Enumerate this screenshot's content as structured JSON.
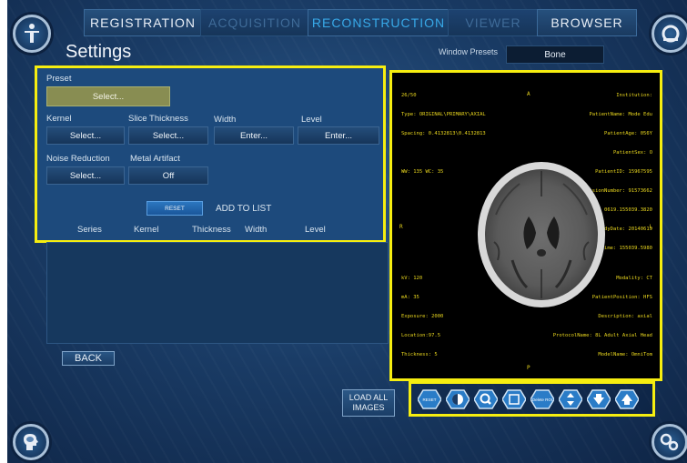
{
  "tabs": [
    {
      "label": "REGISTRATION"
    },
    {
      "label": "ACQUISITION"
    },
    {
      "label": "RECONSTRUCTION"
    },
    {
      "label": "VIEWER"
    },
    {
      "label": "BROWSER"
    }
  ],
  "page": {
    "title": "Settings"
  },
  "window_presets": {
    "label": "Window Presets",
    "value": "Bone"
  },
  "settings": {
    "preset": {
      "label": "Preset",
      "value": "Select..."
    },
    "kernel": {
      "label": "Kernel",
      "value": "Select..."
    },
    "slice_thickness": {
      "label": "Slice Thickness",
      "value": "Select..."
    },
    "width": {
      "label": "Width",
      "value": "Enter..."
    },
    "level": {
      "label": "Level",
      "value": "Enter..."
    },
    "noise_reduction": {
      "label": "Noise Reduction",
      "value": "Select..."
    },
    "metal_artifact": {
      "label": "Metal Artifact",
      "value": "Off"
    },
    "reset_label": "RESET",
    "add_label": "ADD TO LIST",
    "columns": [
      "Series",
      "Kernel",
      "Thickness",
      "Width",
      "Level"
    ]
  },
  "back_label": "BACK",
  "load_all_label": "LOAD ALL IMAGES",
  "viewer": {
    "top_left": [
      "26/50",
      "Type: ORIGINAL\\PRIMARY\\AXIAL",
      "Spacing: 0.4132813\\0.4132813",
      "",
      "WW: 135 WC: 35"
    ],
    "top_right": [
      "Institution:",
      "PatientName: Mode Edu",
      "PatientAge: 056Y",
      "PatientSex: O",
      "PatientID: 15967595",
      "AccessionNumber: 91573662",
      "StudyID: 0619.155039.3820",
      "StudyDate: 20140619",
      "StudyTime: 155039.5980"
    ],
    "bottom_left": [
      "kV: 120",
      "mA: 35",
      "Exposure: 2000",
      "Location:97.5",
      "Thickness: 5"
    ],
    "bottom_right": [
      "Modality: CT",
      "PatientPosition: HFS",
      "Description: axial",
      "ProtocolName: 8L Adult Axial Head",
      "ModelName: OmniTom"
    ],
    "orientation": {
      "top": "A",
      "bottom": "P",
      "left": "R",
      "right": "L"
    }
  },
  "toolbar": [
    {
      "icon": "reset-icon",
      "label": "RESET"
    },
    {
      "icon": "contrast-icon",
      "label": ""
    },
    {
      "icon": "zoom-icon",
      "label": ""
    },
    {
      "icon": "square-icon",
      "label": ""
    },
    {
      "icon": "delete-roi-icon",
      "label": "Delete ROI"
    },
    {
      "icon": "move-icon",
      "label": ""
    },
    {
      "icon": "arrow-down-icon",
      "label": ""
    },
    {
      "icon": "arrow-up-icon",
      "label": ""
    }
  ],
  "colors": {
    "highlight": "#f6ee10",
    "panel": "#1d4a7c",
    "accent": "#38a9e8",
    "overlay_text": "#e9d61e"
  }
}
